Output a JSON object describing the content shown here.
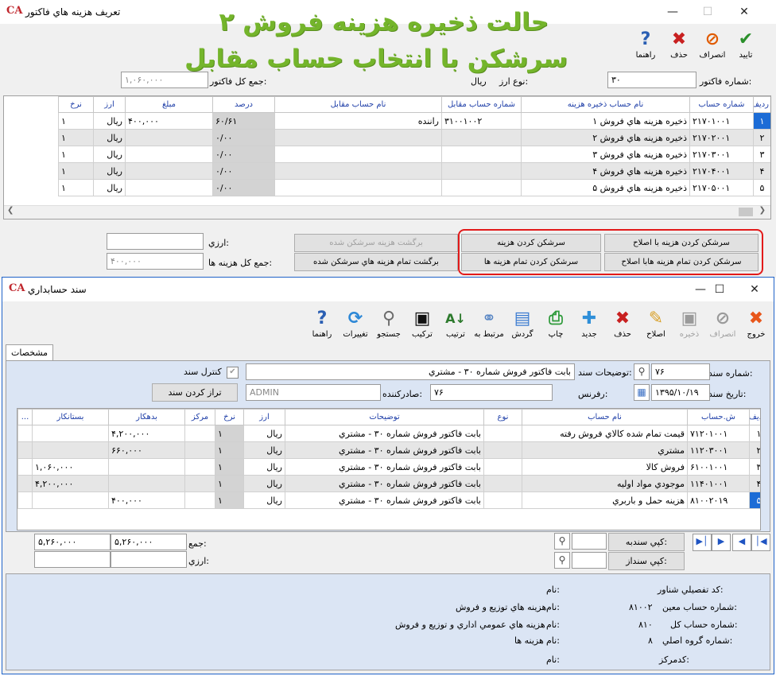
{
  "w1": {
    "title": "تعريف هزينه هاي فاكتور",
    "logo": "CA",
    "toolbar": [
      {
        "label": "تاييد",
        "icon": "check-icon"
      },
      {
        "label": "انصراف",
        "icon": "cancel-icon"
      },
      {
        "label": "حذف",
        "icon": "delete-icon"
      },
      {
        "label": "راهنما",
        "icon": "help-icon"
      }
    ],
    "invoice_no_label": "شماره فاكتور:",
    "invoice_no": "۳۰",
    "currency_type_label": "نوع ارز:",
    "currency_type": "ريال",
    "invoice_total_label": "جمع كل فاكتور:",
    "invoice_total": "۱,۰۶۰,۰۰۰",
    "columns": [
      "رديف",
      "شماره حساب",
      "نام حساب ذخيره هزينه",
      "شماره حساب مقابل",
      "نام حساب مقابل",
      "درصد",
      "مبلغ",
      "ارز",
      "نرخ"
    ],
    "rows": [
      [
        "۱",
        "۲۱۷۰۱۰۰۱",
        "ذخيره هزينه هاي فروش ۱",
        "۳۱۰۰۱۰۰۲",
        "راننده",
        "۶۰/۶۱",
        "۴۰۰,۰۰۰",
        "ريال",
        "۱"
      ],
      [
        "۲",
        "۲۱۷۰۲۰۰۱",
        "ذخيره هزينه هاي فروش ۲",
        "",
        "",
        "۰/۰۰",
        "",
        "ريال",
        "۱"
      ],
      [
        "۳",
        "۲۱۷۰۳۰۰۱",
        "ذخيره هزينه هاي فروش ۳",
        "",
        "",
        "۰/۰۰",
        "",
        "ريال",
        "۱"
      ],
      [
        "۴",
        "۲۱۷۰۴۰۰۱",
        "ذخيره هزينه هاي فروش ۴",
        "",
        "",
        "۰/۰۰",
        "",
        "ريال",
        "۱"
      ],
      [
        "۵",
        "۲۱۷۰۵۰۰۱",
        "ذخيره هزينه هاي فروش ۵",
        "",
        "",
        "۰/۰۰",
        "",
        "ريال",
        "۱"
      ]
    ],
    "currency_label": "ارزي:",
    "currency_value": "",
    "total_cost_label": "جمع كل هزينه ها:",
    "total_cost": "۴۰۰,۰۰۰",
    "buttons": {
      "deduct_with_correction": "سرشكن كردن هزينه با اصلاح",
      "deduct_all_with_correction": "سرشكن كردن تمام هزينه هابا اصلاح",
      "deduct_cost": "سرشكن كردن هزينه",
      "deduct_all_costs": "سرشكن كردن تمام هزينه ها",
      "revert_deducted": "برگشت هزينه سرشكن شده",
      "revert_all_deducted": "برگشت تمام هزينه هاي سرشكن شده"
    }
  },
  "overlay": {
    "line1": "حالت ذخيره هزينه فروش ۲",
    "line2": "سرشكن با انتخاب حساب مقابل"
  },
  "w2": {
    "title": "سند حسابداري",
    "logo": "CA",
    "toolbar": [
      {
        "label": "خروج",
        "icon": "exit-icon",
        "disabled": false
      },
      {
        "label": "انصراف",
        "icon": "cancel-icon",
        "disabled": true
      },
      {
        "label": "ذخيره",
        "icon": "save-icon",
        "disabled": true
      },
      {
        "label": "اصلاح",
        "icon": "edit-icon",
        "disabled": false
      },
      {
        "label": "حذف",
        "icon": "delete-icon",
        "disabled": false
      },
      {
        "label": "جديد",
        "icon": "new-doc-icon",
        "disabled": false
      },
      {
        "label": "چاپ",
        "icon": "print-icon",
        "disabled": false
      },
      {
        "label": "گردش",
        "icon": "turnover-chart-icon",
        "disabled": false
      },
      {
        "label": "مرتبط به",
        "icon": "link-icon",
        "disabled": false
      },
      {
        "label": "ترتيب",
        "icon": "sort-icon",
        "disabled": false
      },
      {
        "label": "تركيب",
        "icon": "merge-icon",
        "disabled": false
      },
      {
        "label": "جستجو",
        "icon": "search-doc-icon",
        "disabled": false
      },
      {
        "label": "تغييرات",
        "icon": "refresh-icon",
        "disabled": false
      },
      {
        "label": "راهنما",
        "icon": "help-icon",
        "disabled": false
      }
    ],
    "tab": "مشخصات",
    "doc_no_label": "شماره سند:",
    "doc_no": "۷۶",
    "doc_desc_label": "توضيحات سند:",
    "doc_desc": "بابت فاكتور فروش شماره ۳۰ - مشتري",
    "doc_control_label": "كنترل سند",
    "doc_date_label": "تاريخ سند:",
    "doc_date": "۱۳۹۵/۱۰/۱۹",
    "reference_label": "رفرنس:",
    "reference": "۷۶",
    "issuer_label": "صادركننده:",
    "issuer": "ADMIN",
    "balance_button": "تراز كردن سند",
    "columns": [
      "رديف",
      "ش.حساب",
      "نام حساب",
      "نوع",
      "توضيحات",
      "ارز",
      "نرخ",
      "مركز",
      "بدهكار",
      "بستانكار",
      "..."
    ],
    "rows": [
      [
        "۱",
        "۷۱۲۰۱۰۰۱",
        "قيمت تمام شده كالاي فروش رفته",
        "",
        "بابت فاكتور فروش شماره ۳۰ - مشتري",
        "ريال",
        "۱",
        "",
        "۴,۲۰۰,۰۰۰",
        "",
        ""
      ],
      [
        "۲",
        "۱۱۲۰۳۰۰۱",
        "مشتري",
        "",
        "بابت فاكتور فروش شماره ۳۰ - مشتري",
        "ريال",
        "۱",
        "",
        "۶۶۰,۰۰۰",
        "",
        ""
      ],
      [
        "۳",
        "۶۱۰۰۱۰۰۱",
        "فروش كالا",
        "",
        "بابت فاكتور فروش شماره ۳۰ - مشتري",
        "ريال",
        "۱",
        "",
        "",
        "۱,۰۶۰,۰۰۰",
        ""
      ],
      [
        "۴",
        "۱۱۴۰۱۰۰۱",
        "موجودي مواد اوليه",
        "",
        "بابت فاكتور فروش شماره ۳۰ - مشتري",
        "ريال",
        "۱",
        "",
        "",
        "۴,۲۰۰,۰۰۰",
        ""
      ],
      [
        "۵",
        "۸۱۰۰۲۰۱۹",
        "هزينه حمل و باربري",
        "",
        "بابت فاكتور فروش شماره ۳۰ - مشتري",
        "ريال",
        "۱",
        "",
        "۴۰۰,۰۰۰",
        "",
        ""
      ]
    ],
    "sum_label": "جمع:",
    "sum_debit": "۵,۲۶۰,۰۰۰",
    "sum_credit": "۵,۲۶۰,۰۰۰",
    "currency_label": "ارزي:",
    "copy_to_label": "كپي سندبه:",
    "copy_from_label": "كپي سنداز:",
    "info": {
      "floating_code_label": "كد تفصيلي شناور:",
      "name_label": "نام:",
      "moin_label": "شماره حساب معين:",
      "moin_value": "۸۱۰۰۲",
      "moin_name": "هزينه هاي توزيع و فروش",
      "kol_label": "شماره حساب كل:",
      "kol_value": "۸۱۰",
      "kol_name": "هزينه هاي عمومي اداري و توزيع و فروش",
      "group_label": "شماره گروه اصلي:",
      "group_value": "۸",
      "group_name": "هزينه ها",
      "center_label": "كدمركز:"
    }
  }
}
